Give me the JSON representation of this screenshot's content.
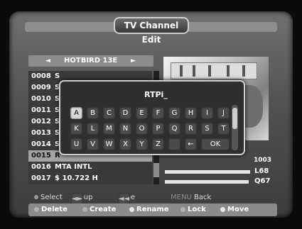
{
  "screen": {
    "title": "TV Channel Edit"
  },
  "satellite": {
    "name": "HOTBIRD 13E",
    "left_arrow": "◄",
    "right_arrow": "►"
  },
  "channels": [
    {
      "num": "0008",
      "name": "S"
    },
    {
      "num": "0009",
      "name": "S"
    },
    {
      "num": "0010",
      "name": "S"
    },
    {
      "num": "0011",
      "name": "S"
    },
    {
      "num": "0012",
      "name": "S"
    },
    {
      "num": "0013",
      "name": "S"
    },
    {
      "num": "0014",
      "name": "S"
    },
    {
      "num": "0015",
      "name": "R"
    },
    {
      "num": "0016",
      "name": "MTA INTL"
    },
    {
      "num": "0017",
      "name": "$ 10.722 H"
    }
  ],
  "info": {
    "text": "1003",
    "level_label": "L68",
    "quality_label": "Q67",
    "level_value": 0.68,
    "quality_value": 0.67
  },
  "keyboard": {
    "input_text": "RTPi_",
    "rows": [
      [
        "A",
        "B",
        "C",
        "D",
        "E",
        "F",
        "G",
        "H",
        "I",
        "J"
      ],
      [
        "K",
        "L",
        "M",
        "N",
        "O",
        "P",
        "Q",
        "R",
        "S",
        "T"
      ],
      [
        "U",
        "V",
        "W",
        "X",
        "Y",
        "Z",
        "",
        "←",
        "OK"
      ]
    ],
    "selected_key": "A"
  },
  "help": {
    "select": "Select",
    "group_key": "◄►",
    "group": "Group",
    "page_key": "◄◄ ►►",
    "page": "Page",
    "menu_key": "MENU",
    "back": "Back"
  },
  "buttons": {
    "delete": "Delete",
    "create": "Create",
    "rename": "Rename",
    "lock": "Lock",
    "move": "Move"
  }
}
